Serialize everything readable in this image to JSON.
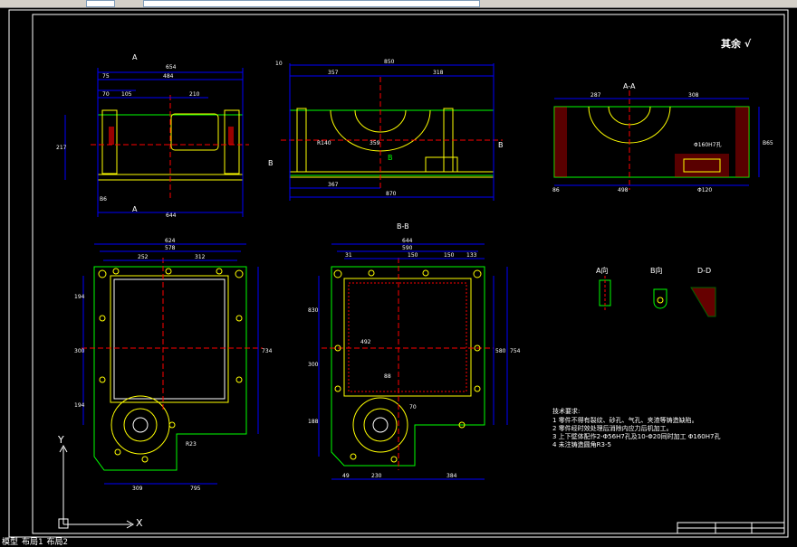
{
  "window": {
    "tabs": [
      "模型",
      "布局1",
      "布局2"
    ]
  },
  "sheet": {
    "title": "其余 √",
    "notes": {
      "heading": "技术要求:",
      "items": [
        "1  零件不得有裂纹、砂孔、气孔、夹渣等铸造缺陷。",
        "2  零件经时效处理后消除内应力后机加工。",
        "3  上下壁体配作2-Φ56H7孔及10-Φ20同时加工 Φ160H7孔",
        "4  未注铸造圆角R3-5"
      ]
    },
    "views": {
      "section_aa": "A-A",
      "section_bb": "B-B",
      "view_a": "A向",
      "view_b": "B向",
      "section_dd": "D-D"
    },
    "dims": {
      "front_top": "654",
      "front_2": "484",
      "front_3": "75",
      "front_4": "70",
      "front_5": "105",
      "front_6": "210",
      "front_h": "217",
      "front_bot": "644",
      "front_b6": "B6",
      "side_top": "850",
      "side_2": "357",
      "side_3": "318",
      "side_4": "10",
      "side_bot1": "367",
      "side_bot2": "870",
      "side_r": "R140",
      "side_359": "359",
      "aa_1": "287",
      "aa_2": "308",
      "aa_bot": "498",
      "aa_86": "86",
      "aa_120": "Φ120",
      "aa_hole": "Φ160H7孔",
      "aa_h": "B65",
      "plan_top": "624",
      "plan_578": "578",
      "plan_252": "252",
      "plan_312": "312",
      "plan_194a": "194",
      "plan_300": "300",
      "plan_194b": "194",
      "plan_734": "734",
      "plan_309": "309",
      "plan_795": "795",
      "plan_r": "R23",
      "bb_644": "644",
      "bb_590": "590",
      "bb_31": "31",
      "bb_150a": "150",
      "bb_150b": "150",
      "bb_133": "133",
      "bb_492": "492",
      "bb_580": "580",
      "bb_754": "754",
      "bb_88": "88",
      "bb_70": "70",
      "bb_49": "49",
      "bb_230": "230",
      "bb_384": "384",
      "bb_188": "188",
      "bb_300": "300",
      "bb_830": "830"
    },
    "labels": {
      "section_a_top": "A",
      "section_a_bot": "A",
      "section_b_left": "B",
      "section_b_mid": "B",
      "section_b_right": "B",
      "axis_y": "Y",
      "axis_x": "X"
    }
  },
  "colors": {
    "background": "#000000",
    "border": "#ffffff",
    "outline": "#00ff00",
    "dimension": "#0000ff",
    "dim_text": "#ffffff",
    "center": "#ff0000",
    "hatch": "#ff0000",
    "edge": "#ffff00"
  }
}
